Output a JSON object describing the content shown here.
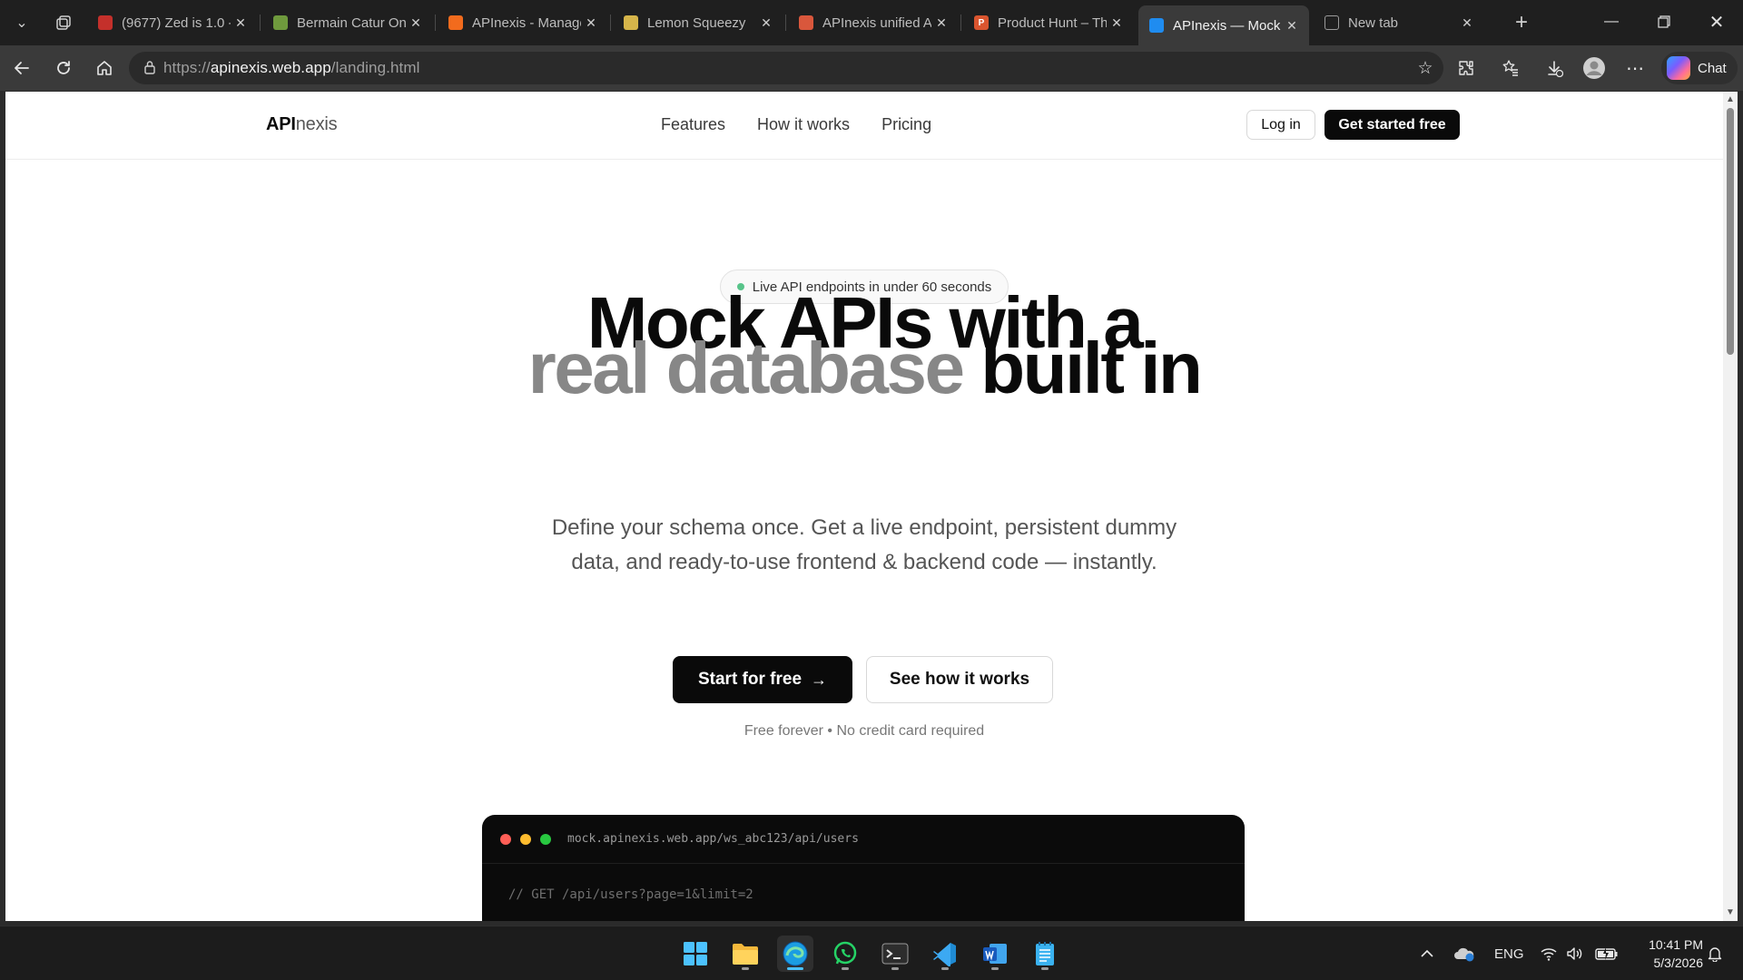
{
  "browser": {
    "tabs": [
      {
        "title": "(9677) Zed is 1.0 -",
        "favicon_color": "#c4302b",
        "active": false
      },
      {
        "title": "Bermain Catur Onl",
        "favicon_color": "#6f9a3d",
        "active": false
      },
      {
        "title": "APInexis - Manage",
        "favicon_color": "#f26b1d",
        "active": false
      },
      {
        "title": "Lemon Squeezy",
        "favicon_color": "#d6b54a",
        "active": false
      },
      {
        "title": "APInexis unified AI",
        "favicon_color": "#d9573c",
        "active": false
      },
      {
        "title": "Product Hunt – Th",
        "favicon_color": "#da552f",
        "favicon_letter": "P",
        "active": false
      },
      {
        "title": "APInexis — Mock A",
        "favicon_color": "#1f8cf0",
        "active": true
      },
      {
        "title": "New tab",
        "favicon_color": "#9a9a9a",
        "active": false
      }
    ],
    "url_prefix": "https://",
    "url_host": "apinexis.web.app",
    "url_path": "/landing.html",
    "chat_label": "Chat"
  },
  "site": {
    "logo_strong": "API",
    "logo_rest": "nexis",
    "nav": [
      "Features",
      "How it works",
      "Pricing"
    ],
    "login_label": "Log in",
    "get_started_label": "Get started free",
    "badge_text": "Live API endpoints in under 60 seconds",
    "headline_line1": "Mock APIs with a",
    "headline_muted": "real database",
    "headline_rest": "built in",
    "subheadline": "Define your schema once. Get a live endpoint, persistent dummy data, and ready-to-use frontend & backend code — instantly.",
    "cta_primary": "Start for free",
    "cta_primary_arrow": "→",
    "cta_secondary": "See how it works",
    "fineprint": "Free forever • No credit card required",
    "terminal_url": "mock.apinexis.web.app/ws_abc123/api/users",
    "terminal_line1": "// GET /api/users?page=1&limit=2"
  },
  "taskbar": {
    "apps": [
      "start",
      "file-explorer",
      "edge",
      "whatsapp",
      "terminal",
      "vscode",
      "word",
      "notepad"
    ],
    "language": "ENG",
    "time": "10:41 PM",
    "date": "5/3/2026"
  },
  "colors": {
    "accent_dark": "#0a0a0a",
    "muted_headline": "#878787",
    "live_dot": "#58c48a",
    "edge_accent": "#4cc2ff"
  }
}
